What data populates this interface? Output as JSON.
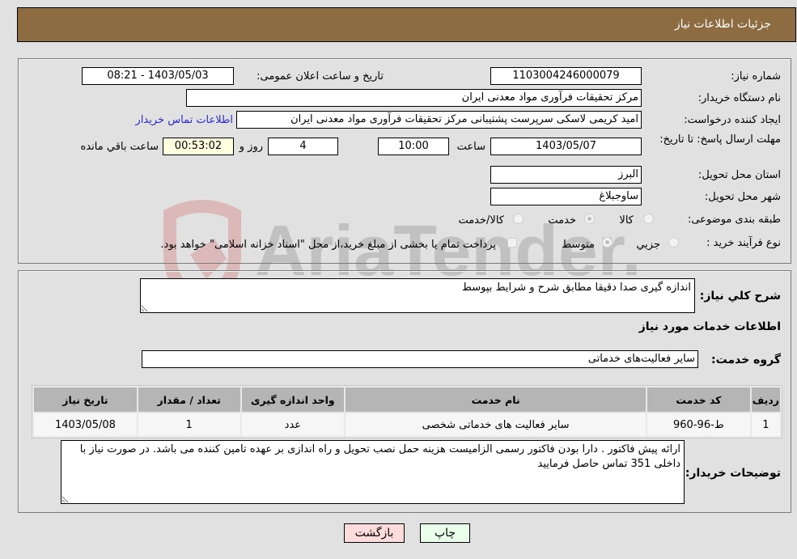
{
  "header": {
    "title": "جزئیات اطلاعات نیاز"
  },
  "need_info": {
    "need_number_label": "شماره نیاز:",
    "need_number": "1103004246000079",
    "announce_label": "تاریخ و ساعت اعلان عمومی:",
    "announce_value": "1403/05/03 - 08:21",
    "buyer_org_label": "نام دستگاه خریدار:",
    "buyer_org": "مرکز تحقیقات فرآوری مواد معدنی ایران",
    "requester_label": "ایجاد کننده درخواست:",
    "requester": "امید کریمی لاسکی سرپرست پشتیبانی مرکز تحقیقات فرآوری مواد معدنی ایران",
    "buyer_contact_link": "اطلاعات تماس خریدار",
    "deadline_label": "مهلت ارسال پاسخ: تا تاریخ:",
    "deadline_date": "1403/05/07",
    "time_label": "ساعت",
    "deadline_time": "10:00",
    "days": "4",
    "days_label": "روز و",
    "remaining": "00:53:02",
    "remaining_label": "ساعت باقي مانده",
    "province_label": "استان محل تحویل:",
    "province": "البرز",
    "city_label": "شهر محل تحویل:",
    "city": "ساوجبلاغ",
    "category_label": "طبقه بندی موضوعی:",
    "category_options": [
      {
        "label": "کالا",
        "selected": false
      },
      {
        "label": "خدمت",
        "selected": true
      },
      {
        "label": "کالا/خدمت",
        "selected": false
      }
    ],
    "process_label": "نوع فرآیند خرید :",
    "process_options": [
      {
        "label": "جزيي",
        "selected": false
      },
      {
        "label": "متوسط",
        "selected": true
      }
    ],
    "treasury_checkbox_label": "پرداخت تمام یا بخشی از مبلغ خرید،از محل \"اسناد خزانه اسلامی\" خواهد بود.",
    "treasury_checked": false
  },
  "details": {
    "description_label": "شرح کلي نیاز:",
    "description": "اندازه گیری صدا دقیقا مطابق شرح و شرایط بپوسط",
    "services_heading": "اطلاعات خدمات مورد نیاز",
    "service_group_label": "گروه خدمت:",
    "service_group": "سایر فعالیت‌های خدماتی",
    "table": {
      "headers": [
        "ردیف",
        "کد خدمت",
        "نام خدمت",
        "واحد اندازه گیری",
        "تعداد / مقدار",
        "تاریخ نیاز"
      ],
      "rows": [
        [
          "1",
          "ط-96-960",
          "سایر فعالیت های خدماتی شخصی",
          "عدد",
          "1",
          "1403/05/08"
        ]
      ]
    },
    "buyer_notes_label": "توضیحات خریدار:",
    "buyer_notes": "ارائه پیش فاکتور . دارا بودن فاکتور رسمی الزامیست هزینه حمل نصب تحویل و راه اندازی بر عهده تامین کننده می باشد. در صورت نیاز با داخلی 351 تماس حاصل فرمایید"
  },
  "buttons": {
    "print": "چاپ",
    "back": "بازگشت"
  },
  "watermark": {
    "text": "AriaTender.neT"
  },
  "colors": {
    "header_bg": "#8e6c42",
    "print_bg": "#eaffea",
    "back_bg": "#ffdcdc",
    "link": "#2a2ad0"
  }
}
